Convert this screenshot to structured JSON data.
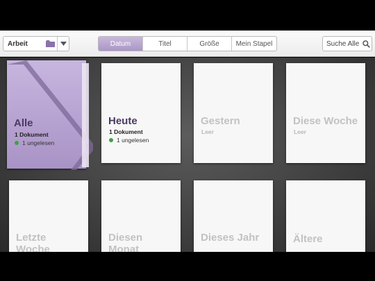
{
  "toolbar": {
    "folder_label": "Arbeit",
    "folder_icon": "folder-icon",
    "dropdown_icon": "chevron-down-icon",
    "tabs": [
      {
        "label": "Datum",
        "active": true
      },
      {
        "label": "Titel",
        "active": false
      },
      {
        "label": "Größe",
        "active": false
      },
      {
        "label": "Mein Stapel",
        "active": false
      }
    ],
    "search_label": "Suche Alle",
    "search_icon": "search-icon"
  },
  "tiles": [
    {
      "title": "Alle",
      "count": "1 Dokument",
      "unread": "1 ungelesen"
    },
    {
      "title": "Heute",
      "count": "1 Dokument",
      "unread": "1 ungelesen"
    },
    {
      "title": "Gestern",
      "empty": "Leer"
    },
    {
      "title": "Diese Woche",
      "empty": "Leer"
    },
    {
      "title_line1": "Letzte",
      "title_line2": "Woche"
    },
    {
      "title_line1": "Diesen",
      "title_line2": "Monat"
    },
    {
      "title": "Dieses Jahr"
    },
    {
      "title": "Ältere"
    }
  ],
  "colors": {
    "accent": "#ab96c6",
    "title_text": "#4a3a62",
    "unread_dot": "#3ca341"
  }
}
